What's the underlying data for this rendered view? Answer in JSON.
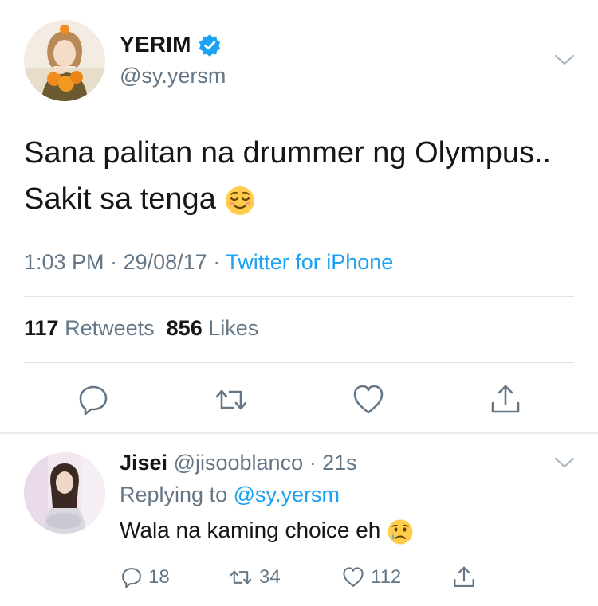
{
  "tweet": {
    "author": {
      "display_name": "YERIM",
      "handle": "@sy.yersm",
      "verified": true,
      "avatar_icon": "profile-photo"
    },
    "text_line1": "Sana palitan na drummer ng Olympus..",
    "text_line2": "Sakit sa tenga",
    "text_emoji": "relieved-face-emoji",
    "time": "1:03 PM",
    "date": "29/08/17",
    "source": "Twitter for iPhone",
    "retweets_count": "117",
    "retweets_label": "Retweets",
    "likes_count": "856",
    "likes_label": "Likes",
    "actions": [
      "reply-icon",
      "retweet-icon",
      "like-icon",
      "share-icon"
    ]
  },
  "reply": {
    "display_name": "Jisei",
    "handle": "@jisooblanco",
    "age": "21s",
    "replying_prefix": "Replying to",
    "replying_to": "@sy.yersm",
    "text": "Wala na kaming choice eh",
    "text_emoji": "crying-face-emoji",
    "reply_count": "18",
    "retweet_count": "34",
    "like_count": "112"
  },
  "colors": {
    "accent": "#1da1f2",
    "text": "#14171a",
    "muted": "#657786",
    "divider": "#dfe3e8"
  }
}
